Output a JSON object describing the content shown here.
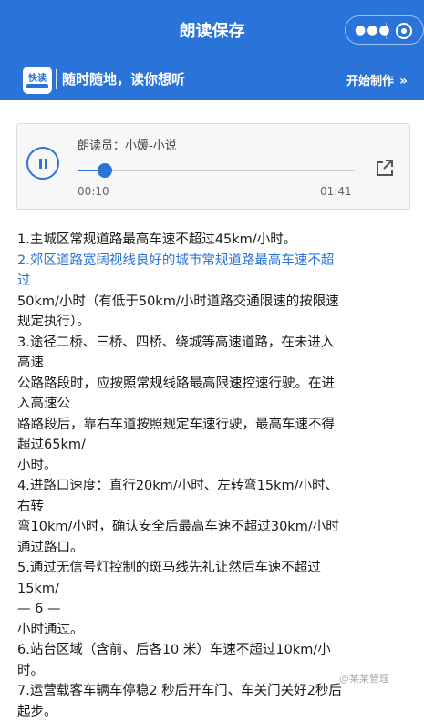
{
  "header": {
    "title": "朗读保存",
    "menu_icon": "more-dots-icon",
    "close_icon": "target-icon"
  },
  "banner": {
    "logo_text": "快读",
    "slogan": "随时随地，读你想听",
    "start_label": "开始制作",
    "start_chevron": "»"
  },
  "player": {
    "narrator": "朗读员：小媛-小说",
    "current_time": "00:10",
    "total_time": "01:41",
    "progress": 0.1,
    "state": "playing",
    "colors": {
      "accent": "#2a73d9"
    }
  },
  "content": {
    "lines": [
      "1.主城区常规道路最高车速不超过45km/小时。",
      "2.郊区道路宽阔视线良好的城市常规道路最高车速不超",
      "过",
      "50km/小时（有低于50km/小时道路交通限速的按限速",
      "规定执行）。",
      "3.途径二桥、三桥、四桥、绕城等高速道路，在未进入",
      "高速",
      "公路路段时，应按照常规线路最高限速控速行驶。在进",
      "入高速公",
      "路路段后，靠右车道按照规定车速行驶，最高车速不得",
      "超过65km/",
      "小时。",
      "4.进路口速度：直行20km/小时、左转弯15km/小时、",
      "右转",
      "弯10km/小时，确认安全后最高车速不超过30km/小时",
      "通过路口。",
      "5.通过无信号灯控制的斑马线先礼让然后车速不超过",
      "15km/",
      "— 6 —",
      "小时通过。",
      "6.站台区域（含前、后各10 米）车速不超过10km/小",
      "时。",
      "7.运营载客车辆车停稳2 秒后开车门、车关门关好2秒后",
      "起步。"
    ],
    "highlight_lines": [
      1,
      2
    ]
  },
  "watermark": "@某某管理"
}
